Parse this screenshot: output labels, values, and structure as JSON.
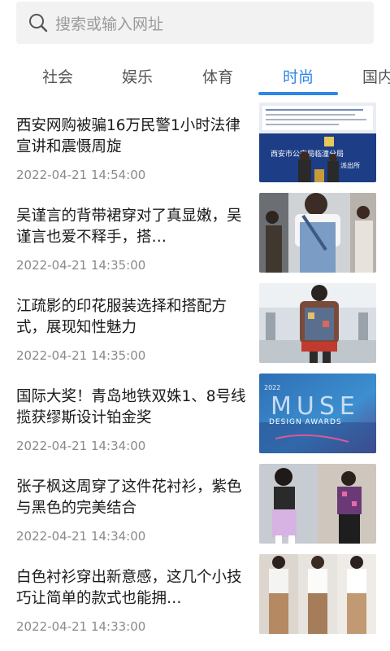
{
  "search": {
    "placeholder": "搜索或输入网址"
  },
  "tabs": [
    {
      "label": "社会",
      "active": false
    },
    {
      "label": "娱乐",
      "active": false
    },
    {
      "label": "体育",
      "active": false
    },
    {
      "label": "时尚",
      "active": true
    },
    {
      "label": "国内",
      "active": false
    }
  ],
  "news": [
    {
      "title": "西安网购被骗16万民警1小时法律宣讲和震慑周旋",
      "time": "2022-04-21 14:54:00",
      "thumb_caption": "西安市公安局临潼分局",
      "thumb_sub": "派出所"
    },
    {
      "title": "吴谨言的背带裙穿对了真显嫩，吴谨言也爱不释手，搭…",
      "time": "2022-04-21 14:35:00"
    },
    {
      "title": "江疏影的印花服装选择和搭配方式，展现知性魅力",
      "time": "2022-04-21 14:35:00"
    },
    {
      "title": "国际大奖！青岛地铁双姝1、8号线揽获缪斯设计铂金奖",
      "time": "2022-04-21 14:34:00",
      "thumb_caption": "DESIGN AWARDS",
      "thumb_big": "MUSE",
      "thumb_year": "2022"
    },
    {
      "title": "张子枫这周穿了这件花衬衫，紫色与黑色的完美结合",
      "time": "2022-04-21 14:34:00"
    },
    {
      "title": "白色衬衫穿出新意感，这几个小技巧让简单的款式也能拥…",
      "time": "2022-04-21 14:33:00"
    }
  ],
  "colors": {
    "accent": "#2f86e6",
    "tab_text": "#555555",
    "time_text": "#8a8a8a",
    "search_bg": "#f2f2f2"
  }
}
